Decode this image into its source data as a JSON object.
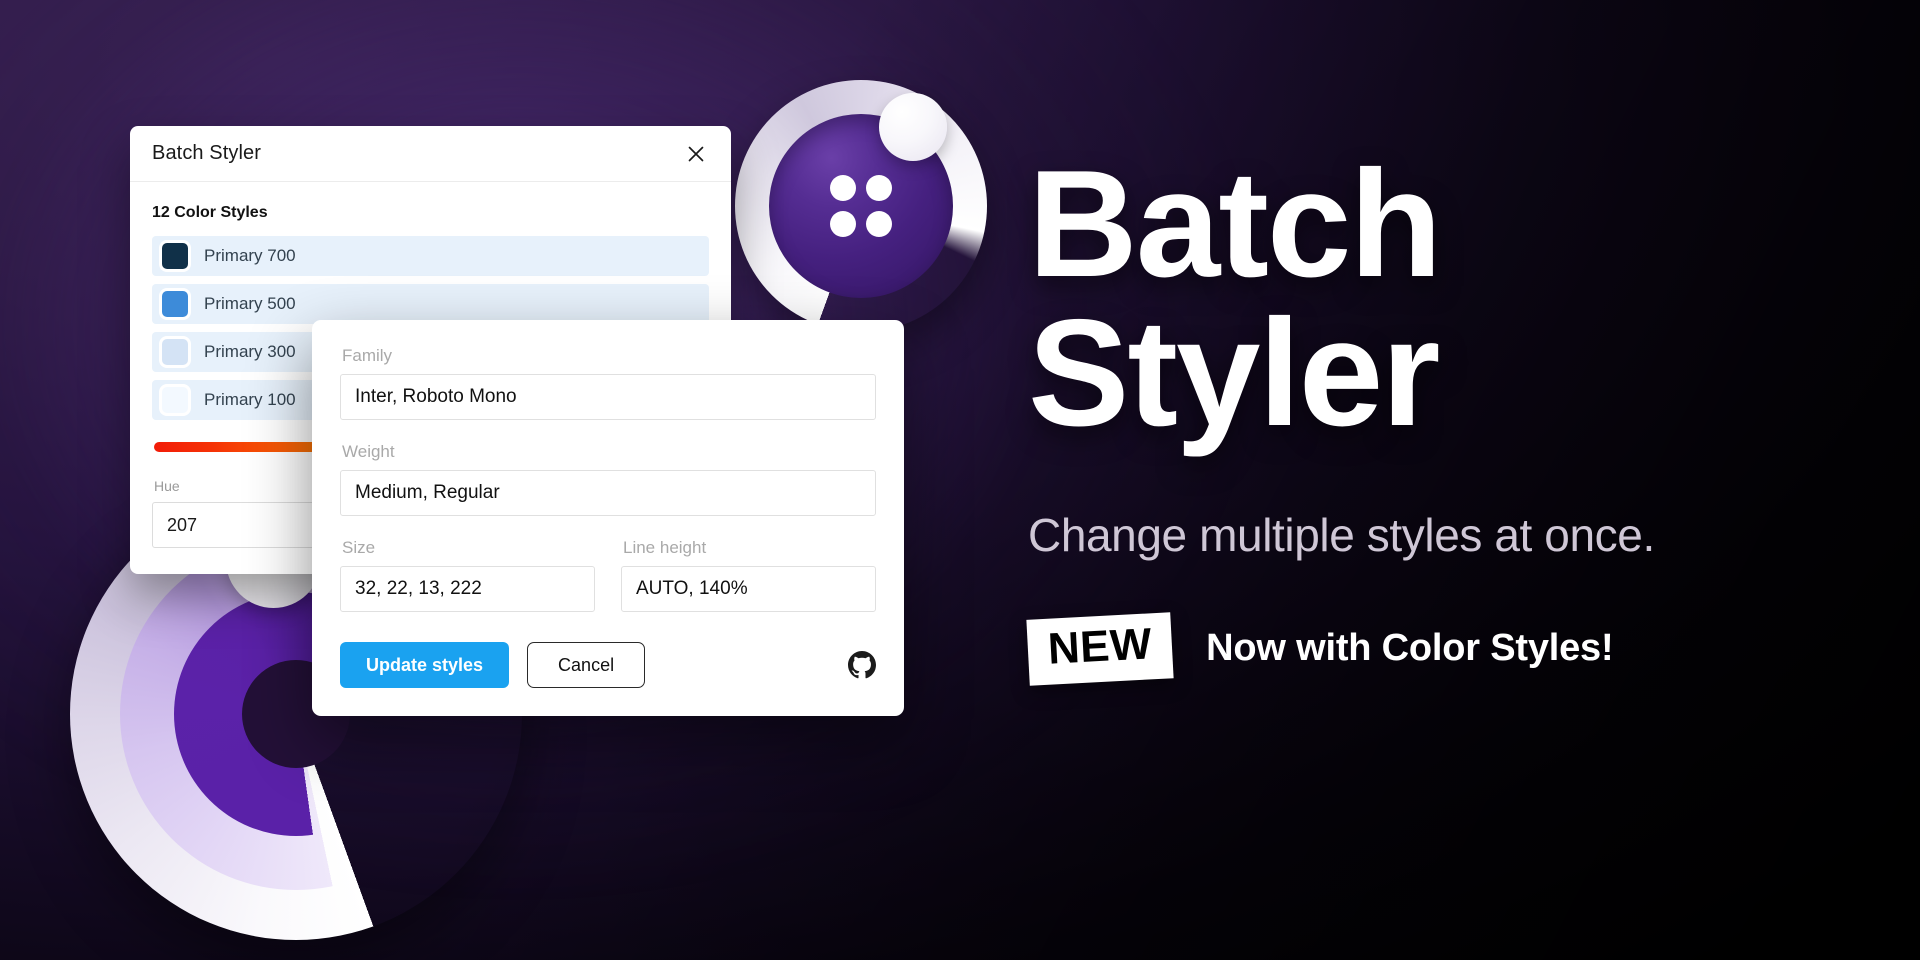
{
  "background": {
    "gradient_from": "#3b2357",
    "gradient_to": "#000000"
  },
  "plugin_window": {
    "title": "Batch Styler",
    "close_icon": "close-icon",
    "section_title": "12 Color Styles",
    "color_styles": [
      {
        "name": "Primary 700",
        "color": "#103048"
      },
      {
        "name": "Primary 500",
        "color": "#3d8bd9"
      },
      {
        "name": "Primary 300",
        "color": "#d4e3f5"
      },
      {
        "name": "Primary 100",
        "color": "#f3f9ff"
      }
    ],
    "hue": {
      "label": "Hue",
      "value": "207"
    }
  },
  "front_dialog": {
    "fields": {
      "family": {
        "label": "Family",
        "value": "Inter, Roboto Mono"
      },
      "weight": {
        "label": "Weight",
        "value": "Medium, Regular"
      },
      "size": {
        "label": "Size",
        "value": "32, 22, 13, 222"
      },
      "line_height": {
        "label": "Line height",
        "value": "AUTO, 140%"
      }
    },
    "actions": {
      "primary_label": "Update styles",
      "secondary_label": "Cancel",
      "github_icon": "github-icon"
    },
    "accent_color": "#1aa2f0"
  },
  "hero": {
    "title_line1": "Batch",
    "title_line2": "Styler",
    "subtitle": "Change multiple styles at once.",
    "badge": "NEW",
    "badge_caption": "Now with Color Styles!"
  }
}
